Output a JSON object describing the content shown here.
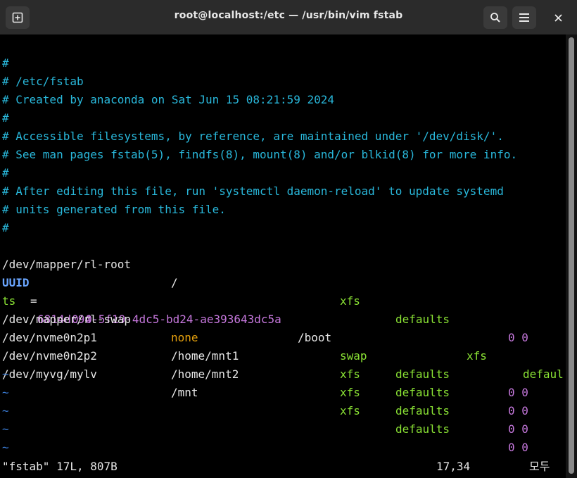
{
  "window": {
    "title": "root@localhost:/etc — /usr/bin/vim fstab"
  },
  "editor": {
    "lines": [
      {
        "cmt": "#"
      },
      {
        "cmt": "# /etc/fstab"
      },
      {
        "cmt": "# Created by anaconda on Sat Jun 15 08:21:59 2024"
      },
      {
        "cmt": "#"
      },
      {
        "cmt": "# Accessible filesystems, by reference, are maintained under '/dev/disk/'."
      },
      {
        "cmt": "# See man pages fstab(5), findfs(8), mount(8) and/or blkid(8) for more info."
      },
      {
        "cmt": "#"
      },
      {
        "cmt": "# After editing this file, run 'systemctl daemon-reload' to update systemd"
      },
      {
        "cmt": "# units generated from this file."
      },
      {
        "cmt": "#"
      }
    ],
    "entries": {
      "e1": {
        "dev": "/dev/mapper/rl-root",
        "mount": "/",
        "type": "xfs",
        "opts": "defaults",
        "nums": "0 0"
      },
      "uuid": {
        "key": "UUID",
        "eq": "=",
        "value": "6814dc94-5f19-4dc5-bd24-ae393643dc5a",
        "mount": "/boot",
        "type": "xfs",
        "opts_head": "defaul",
        "opts_tail": "ts",
        "nums": "0 0"
      },
      "e3": {
        "dev": "/dev/mapper/rl-swap",
        "mount": "none",
        "type": "swap",
        "opts": "defaults",
        "nums": "0 0"
      },
      "e4": {
        "dev": "/dev/nvme0n2p1",
        "mount": "/home/mnt1",
        "type": "xfs",
        "opts": "defaults",
        "nums": "0 0"
      },
      "e5": {
        "dev": "/dev/nvme0n2p2",
        "mount": "/home/mnt2",
        "type": "xfs",
        "opts": "defaults",
        "nums": "0 0"
      },
      "e6": {
        "dev": "/dev/myvg/mylv",
        "mount": "/mnt",
        "type": "xfs",
        "opts": "defaults",
        "nums": "0 0"
      }
    },
    "tilde": "~"
  },
  "status": {
    "file": "\"fstab\" 17L, 807B",
    "position": "17,34",
    "scroll": "모두"
  }
}
